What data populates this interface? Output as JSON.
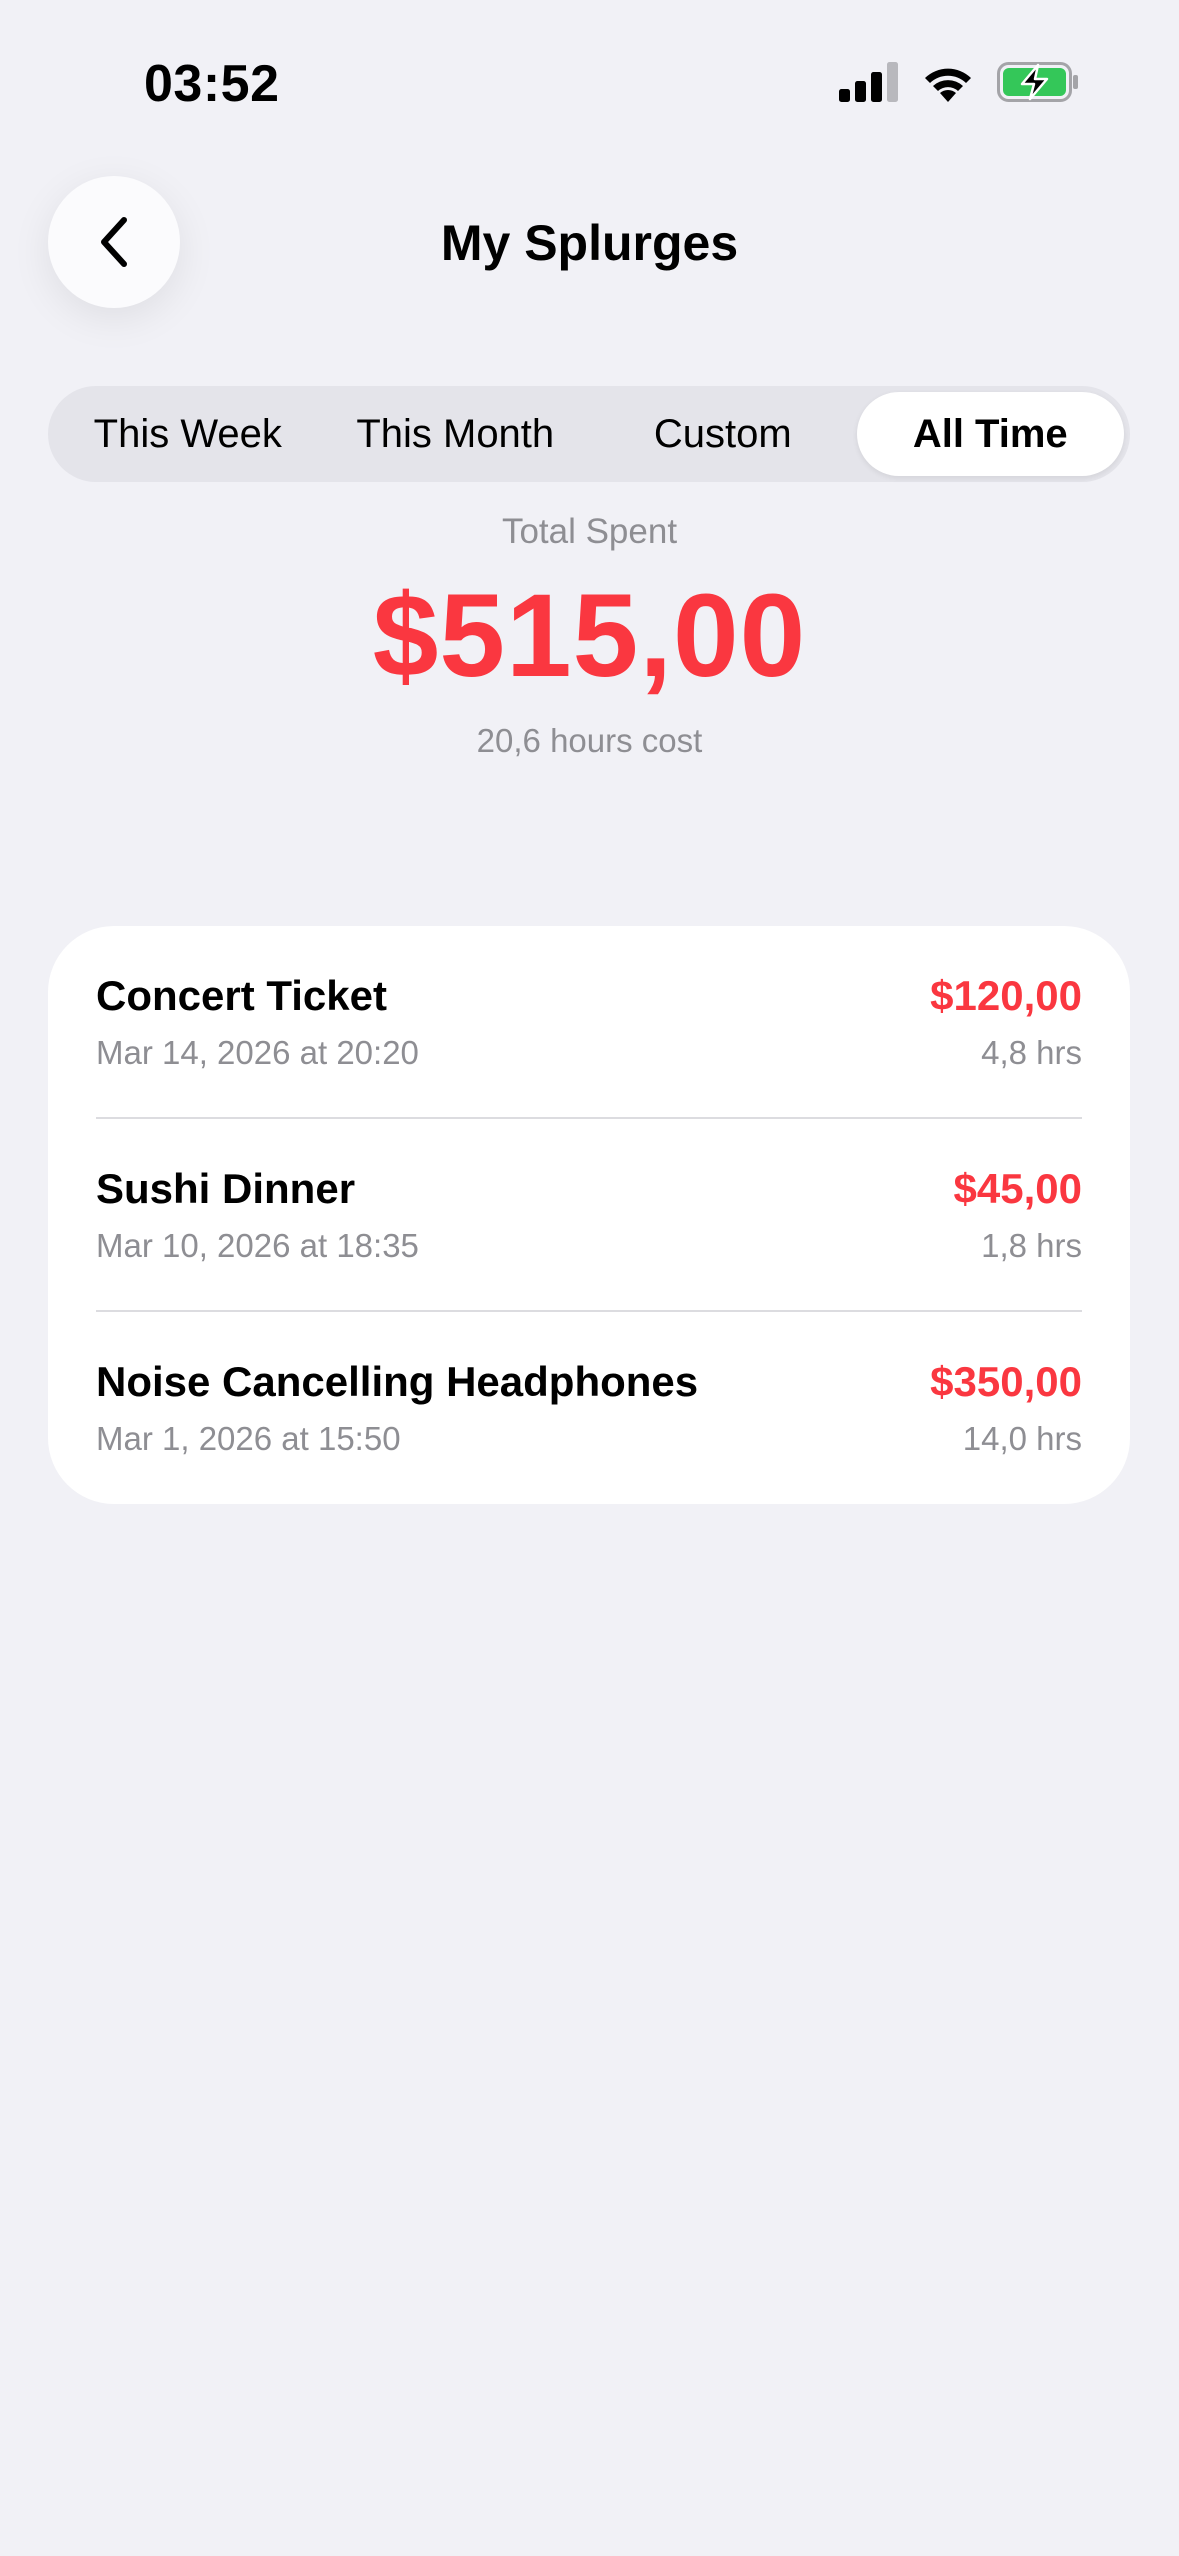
{
  "status_bar": {
    "time": "03:52",
    "icons": [
      "cellular-signal-icon",
      "wifi-icon",
      "battery-charging-icon"
    ],
    "battery_color": "#34c759"
  },
  "nav": {
    "back_icon": "chevron-left-icon",
    "title": "My Splurges"
  },
  "filters": {
    "options": [
      "This Week",
      "This Month",
      "Custom",
      "All Time"
    ],
    "selected": "All Time"
  },
  "summary": {
    "label": "Total Spent",
    "amount": "$515,00",
    "hours": "20,6 hours cost",
    "accent_color": "#fa3740"
  },
  "splurges": [
    {
      "name": "Concert Ticket",
      "date": "Mar 14, 2026 at 20:20",
      "amount": "$120,00",
      "hours": "4,8 hrs"
    },
    {
      "name": "Sushi Dinner",
      "date": "Mar 10, 2026 at 18:35",
      "amount": "$45,00",
      "hours": "1,8 hrs"
    },
    {
      "name": "Noise Cancelling Headphones",
      "date": "Mar 1, 2026 at 15:50",
      "amount": "$350,00",
      "hours": "14,0 hrs"
    }
  ]
}
